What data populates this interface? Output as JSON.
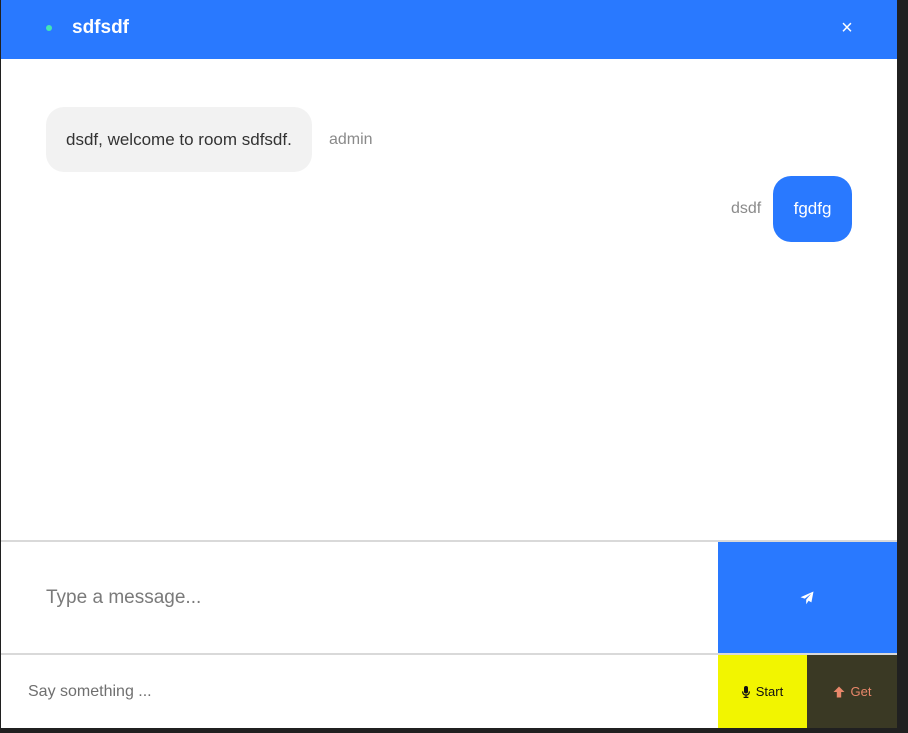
{
  "header": {
    "title": "sdfsdf",
    "close_symbol": "×",
    "status_color": "#43e6b3",
    "accent_color": "#2979ff"
  },
  "messages": [
    {
      "sender": "admin",
      "text": "dsdf, welcome to room sdfsdf.",
      "side": "left"
    },
    {
      "sender": "dsdf",
      "text": "fgdfg",
      "side": "right"
    }
  ],
  "composer": {
    "placeholder": "Type a message...",
    "send_icon": "paper-plane-icon"
  },
  "voice": {
    "placeholder": "Say something ...",
    "start_label": "Start",
    "start_icon": "microphone-icon",
    "get_label": "Get",
    "get_icon": "arrow-up-icon",
    "start_color": "#f2f500",
    "get_color": "#3a3924"
  }
}
